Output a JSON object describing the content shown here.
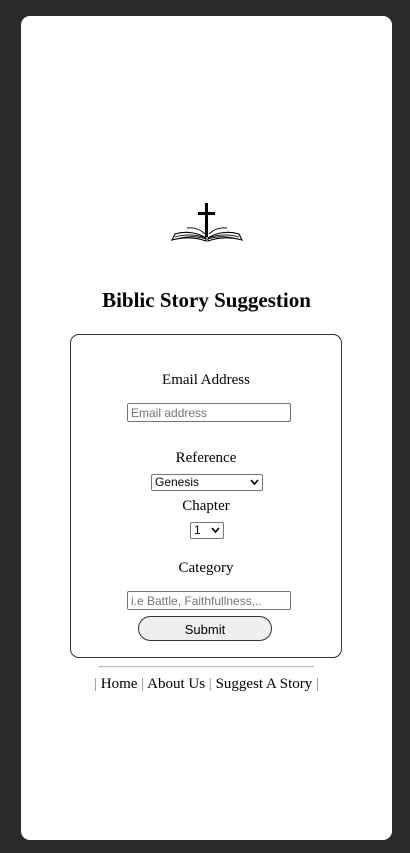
{
  "header": {
    "logo_icon": "cross-book-icon",
    "title": "Biblic Story Suggestion"
  },
  "form": {
    "email": {
      "label": "Email Address",
      "placeholder": "Email address",
      "value": ""
    },
    "reference": {
      "label": "Reference",
      "selected": "Genesis"
    },
    "chapter": {
      "label": "Chapter",
      "selected": "1"
    },
    "category": {
      "label": "Category",
      "placeholder": "i.e Battle, Faithfullness,..",
      "value": ""
    },
    "submit_label": "Submit"
  },
  "footer": {
    "separator": "|",
    "links": [
      "Home",
      "About Us",
      "Suggest A Story"
    ]
  },
  "colors": {
    "page_background": "#2b2b2b",
    "card_background": "#ffffff",
    "button_background": "#efefef"
  }
}
